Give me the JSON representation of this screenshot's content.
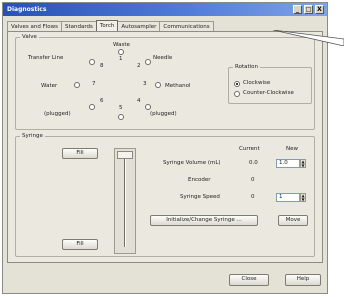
{
  "window": {
    "title": "Diagnostics",
    "controls": [
      "_",
      "□",
      "X"
    ]
  },
  "tabs": [
    {
      "label": "Valves and Flows",
      "active": false
    },
    {
      "label": "Standards",
      "active": false
    },
    {
      "label": "Torch",
      "active": true
    },
    {
      "label": "Autosampler",
      "active": false
    },
    {
      "label": "Communications",
      "active": false
    }
  ],
  "valve": {
    "legend": "Valve",
    "nodes": {
      "waste": "Waste",
      "transfer_line": "Transfer Line",
      "needle": "Needle",
      "water": "Water",
      "methanol": "Methanol",
      "plugged_left": "(plugged)",
      "plugged_right": "(plugged)"
    },
    "port_numbers": [
      "1",
      "2",
      "3",
      "4",
      "5",
      "6",
      "7",
      "8"
    ]
  },
  "rotation": {
    "legend": "Rotation",
    "options": [
      {
        "label": "Clockwise",
        "checked": true
      },
      {
        "label": "Counter-Clockwise",
        "checked": false
      }
    ]
  },
  "syringe": {
    "legend": "Syringe",
    "top_button": "Fill",
    "bottom_button": "Fill",
    "col_current": "Current",
    "col_new": "New",
    "rows": [
      {
        "label": "Syringe Volume (mL)",
        "current": "0.0",
        "new": "1.0"
      },
      {
        "label": "Encoder",
        "current": "0",
        "new": ""
      },
      {
        "label": "Syringe Speed",
        "current": "0",
        "new": "1"
      }
    ],
    "initialize_button": "Initialize/Change Syringe ...",
    "move_button": "Move"
  },
  "footer": {
    "close_button": "Close",
    "help_button": "Help"
  }
}
